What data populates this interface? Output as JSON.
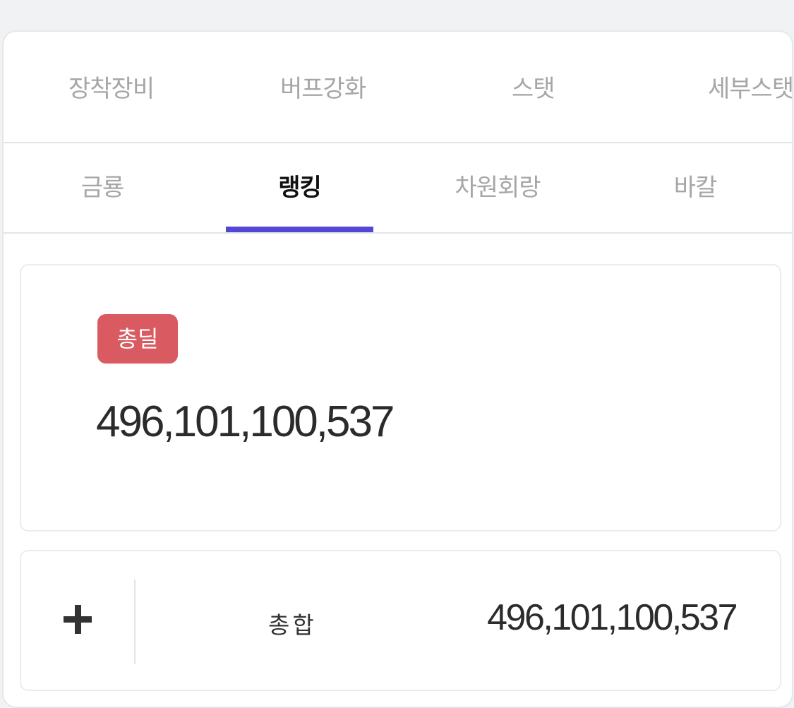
{
  "top_tabs": [
    "장착장비",
    "버프강화",
    "스탯",
    "세부스탯"
  ],
  "sub_tabs": [
    "금룡",
    "랭킹",
    "차원회랑",
    "바칼"
  ],
  "active_sub_tab": "랭킹",
  "total_card": {
    "badge": "총딜",
    "value": "496,101,100,537"
  },
  "summary_row": {
    "expand_icon": "plus-icon",
    "label": "총합",
    "value": "496,101,100,537"
  },
  "colors": {
    "accent": "#5547d6",
    "badge": "#d95b61"
  }
}
